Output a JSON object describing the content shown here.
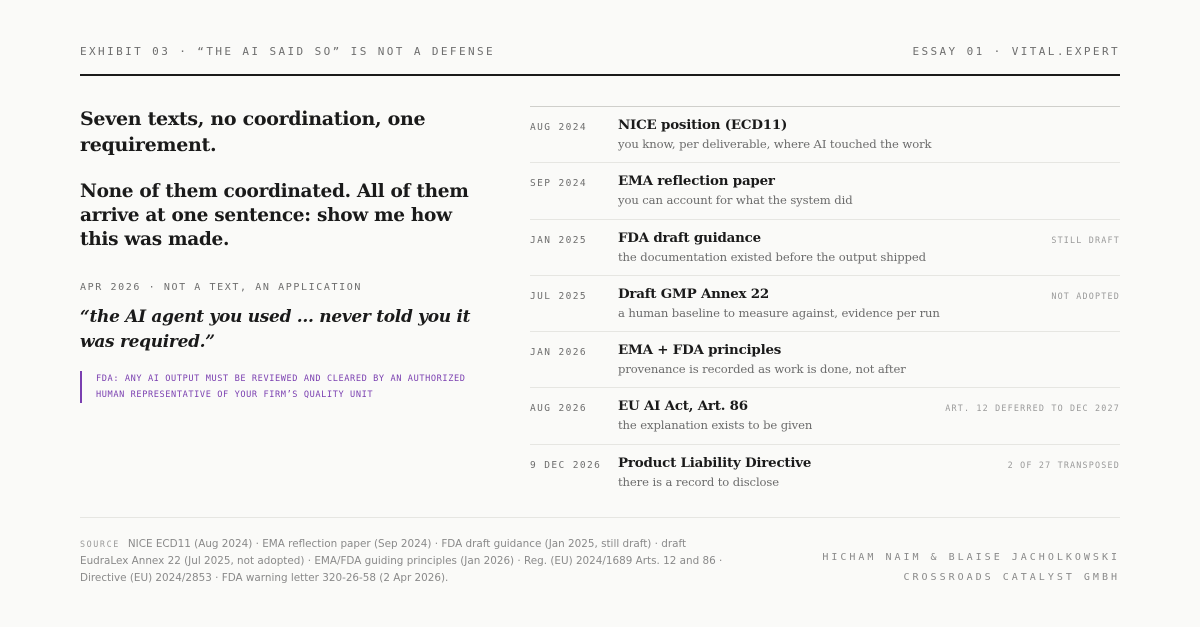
{
  "header": {
    "left": "EXHIBIT 03 · “THE AI SAID SO” IS NOT A DEFENSE",
    "right": "ESSAY 01 · VITAL.EXPERT"
  },
  "left": {
    "headline1": "Seven texts, no coordination, one requirement.",
    "headline2": "None of them coordinated. All of them arrive at one sentence: show me how this was made.",
    "app_label": "APR 2026 · NOT A TEXT, AN APPLICATION",
    "quote": "“the AI agent you used ... never told you it was required.”",
    "fda_note": "FDA: ANY AI OUTPUT MUST BE REVIEWED AND CLEARED BY AN AUTHORIZED HUMAN REPRESENTATIVE OF YOUR FIRM’S QUALITY UNIT"
  },
  "timeline": [
    {
      "date": "AUG 2024",
      "title": "NICE position (ECD11)",
      "desc": "you know, per deliverable, where AI touched the work",
      "status": ""
    },
    {
      "date": "SEP 2024",
      "title": "EMA reflection paper",
      "desc": "you can account for what the system did",
      "status": ""
    },
    {
      "date": "JAN 2025",
      "title": "FDA draft guidance",
      "desc": "the documentation existed before the output shipped",
      "status": "STILL DRAFT"
    },
    {
      "date": "JUL 2025",
      "title": "Draft GMP Annex 22",
      "desc": "a human baseline to measure against, evidence per run",
      "status": "NOT ADOPTED"
    },
    {
      "date": "JAN 2026",
      "title": "EMA + FDA principles",
      "desc": "provenance is recorded as work is done, not after",
      "status": ""
    },
    {
      "date": "AUG 2026",
      "title": "EU AI Act, Art. 86",
      "desc": "the explanation exists to be given",
      "status": "ART. 12 DEFERRED TO DEC 2027"
    },
    {
      "date": "9 DEC 2026",
      "title": "Product Liability Directive",
      "desc": "there is a record to disclose",
      "status": "2 OF 27 TRANSPOSED"
    }
  ],
  "footer": {
    "source_label": "SOURCE",
    "source_text": "NICE ECD11 (Aug 2024) · EMA reflection paper (Sep 2024) · FDA draft guidance (Jan 2025, still draft) · draft EudraLex Annex 22 (Jul 2025, not adopted) · EMA/FDA guiding principles (Jan 2026) · Reg. (EU) 2024/1689 Arts. 12 and 86 · Directive (EU) 2024/2853 · FDA warning letter 320-26-58 (2 Apr 2026).",
    "authors": "HICHAM NAIM & BLAISE JACHOLKOWSKI",
    "company": "CROSSROADS CATALYST GMBH"
  },
  "colors": {
    "accent": "#7a3fb0",
    "text": "#1a1a1a",
    "muted": "#6e6e6e",
    "background": "#fafaf8"
  }
}
